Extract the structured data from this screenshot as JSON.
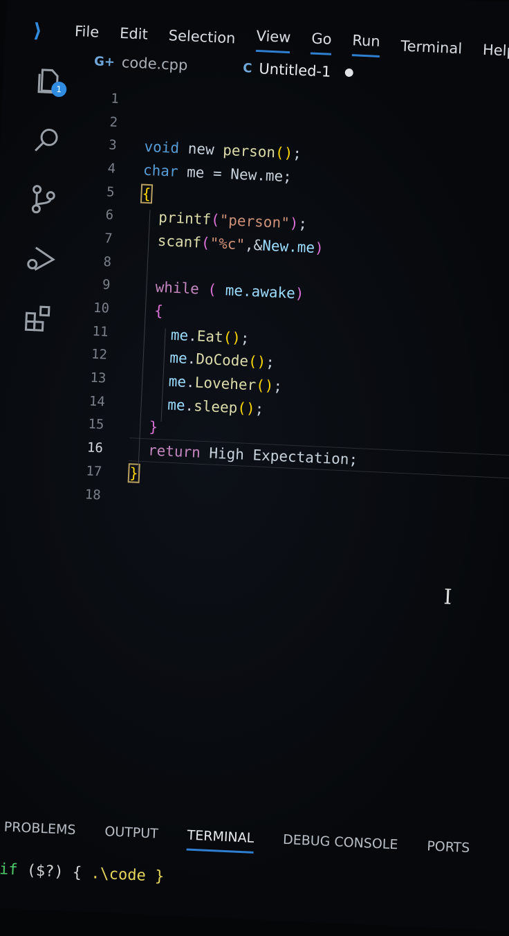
{
  "menu": [
    "File",
    "Edit",
    "Selection",
    "View",
    "Go",
    "Run",
    "Terminal",
    "Help"
  ],
  "activity_badge": "1",
  "tabs": [
    {
      "label": "code.cpp",
      "icon": "G+"
    },
    {
      "label": "Untitled-1",
      "icon": "C"
    }
  ],
  "line_numbers": [
    "1",
    "2",
    "3",
    "4",
    "5",
    "6",
    "7",
    "8",
    "9",
    "10",
    "11",
    "12",
    "13",
    "14",
    "15",
    "16",
    "17",
    "18"
  ],
  "code": [
    [],
    [],
    [
      [
        "kw",
        "void"
      ],
      [
        "id",
        " new "
      ],
      [
        "fn",
        "person"
      ],
      [
        "br",
        "()"
      ],
      [
        "id",
        ";"
      ]
    ],
    [
      [
        "kw",
        "char"
      ],
      [
        "id",
        " me = New.me;"
      ]
    ],
    [
      [
        "br",
        "{"
      ]
    ],
    [
      [
        "id",
        "  "
      ],
      [
        "fn",
        "printf"
      ],
      [
        "pr",
        "("
      ],
      [
        "st",
        "\"person\""
      ],
      [
        "pr",
        ")"
      ],
      [
        "id",
        ";"
      ]
    ],
    [
      [
        "id",
        "  "
      ],
      [
        "fn",
        "scanf"
      ],
      [
        "pr",
        "("
      ],
      [
        "st",
        "\"%c\""
      ],
      [
        "id",
        ",&"
      ],
      [
        "nm",
        "New.me"
      ],
      [
        "pr",
        ")"
      ]
    ],
    [],
    [
      [
        "id",
        "  "
      ],
      [
        "ct",
        "while"
      ],
      [
        "pr",
        " ( "
      ],
      [
        "nm",
        "me.awake"
      ],
      [
        "pr",
        ")"
      ]
    ],
    [
      [
        "id",
        "  "
      ],
      [
        "pr",
        "{"
      ]
    ],
    [
      [
        "id",
        "    "
      ],
      [
        "nm",
        "me"
      ],
      [
        "id",
        "."
      ],
      [
        "fn",
        "Eat"
      ],
      [
        "br",
        "()"
      ],
      [
        "id",
        ";"
      ]
    ],
    [
      [
        "id",
        "    "
      ],
      [
        "nm",
        "me"
      ],
      [
        "id",
        "."
      ],
      [
        "fn",
        "DoCode"
      ],
      [
        "br",
        "()"
      ],
      [
        "id",
        ";"
      ]
    ],
    [
      [
        "id",
        "    "
      ],
      [
        "nm",
        "me"
      ],
      [
        "id",
        "."
      ],
      [
        "fn",
        "Loveher"
      ],
      [
        "br",
        "()"
      ],
      [
        "id",
        ";"
      ]
    ],
    [
      [
        "id",
        "    "
      ],
      [
        "nm",
        "me"
      ],
      [
        "id",
        "."
      ],
      [
        "fn",
        "sleep"
      ],
      [
        "br",
        "()"
      ],
      [
        "id",
        ";"
      ]
    ],
    [
      [
        "id",
        "  "
      ],
      [
        "pr",
        "}"
      ]
    ],
    [
      [
        "id",
        "  "
      ],
      [
        "ct",
        "return"
      ],
      [
        "id",
        " High Expectation;"
      ]
    ],
    [
      [
        "br",
        "}"
      ]
    ],
    []
  ],
  "panel_tabs": [
    "PROBLEMS",
    "OUTPUT",
    "TERMINAL",
    "DEBUG CONSOLE",
    "PORTS"
  ],
  "terminal_line": {
    "a": "if",
    "b": " ($?) { ",
    "c": ".\\code }"
  }
}
